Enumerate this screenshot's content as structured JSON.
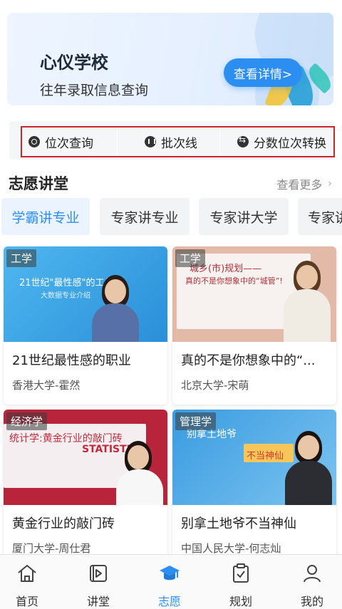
{
  "banner": {
    "title": "心仪学校",
    "subtitle": "往年录取信息查询",
    "button_label": "查看详情>"
  },
  "quick_links": [
    {
      "label": "位次查询",
      "icon": "search-icon"
    },
    {
      "label": "批次线",
      "icon": "bars-icon"
    },
    {
      "label": "分数位次转换",
      "icon": "swap-icon"
    }
  ],
  "section": {
    "title": "志愿讲堂",
    "more_label": "查看更多",
    "more_icon": "chevron-right-icon"
  },
  "tabs": [
    {
      "label": "学霸讲专业",
      "active": true
    },
    {
      "label": "专家讲专业",
      "active": false
    },
    {
      "label": "专家讲大学",
      "active": false
    },
    {
      "label": "专家讲",
      "active": false
    }
  ],
  "cards": [
    {
      "tag": "工学",
      "title": "21世纪最性感的职业",
      "author": "香港大学-霍然",
      "board_text_1": "21世纪\"最性感\"的工作",
      "board_text_2": "大数据专业介绍"
    },
    {
      "tag": "工学",
      "title": "真的不是你想象中的“...",
      "author": "北京大学-宋萌",
      "board_text_1": "城乡(市)规划——",
      "board_text_2": "真的不是你想象中的“城管”!"
    },
    {
      "tag": "经济学",
      "title": "黄金行业的敲门砖",
      "author": "厦门大学-周仕君",
      "board_text_1": "统计学:黄金行业的敲门砖",
      "board_text_2": "STATISTICS"
    },
    {
      "tag": "管理学",
      "title": "别拿土地爷不当神仙",
      "author": "中国人民大学-何志灿",
      "board_text_1": "别拿土地爷",
      "board_text_2": "不当神仙"
    }
  ],
  "bottom_nav": [
    {
      "label": "首页",
      "icon": "home-icon",
      "active": false
    },
    {
      "label": "讲堂",
      "icon": "video-icon",
      "active": false
    },
    {
      "label": "志愿",
      "icon": "graduation-cap-icon",
      "active": true
    },
    {
      "label": "规划",
      "icon": "clipboard-check-icon",
      "active": false
    },
    {
      "label": "我的",
      "icon": "user-icon",
      "active": false
    }
  ],
  "colors": {
    "accent": "#2b8ef0",
    "highlight_frame": "#c8262c"
  }
}
